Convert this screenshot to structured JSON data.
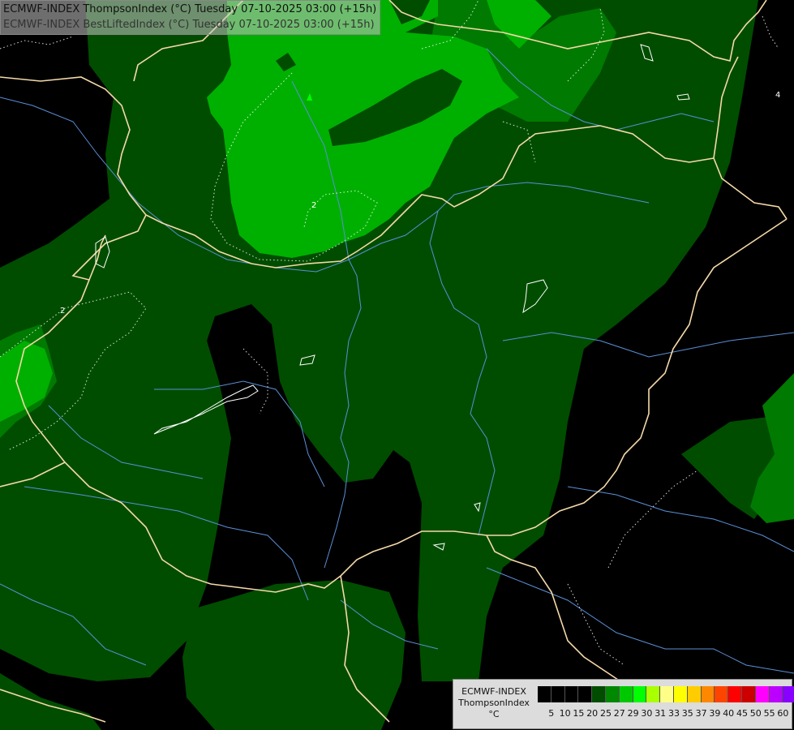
{
  "title": {
    "line1": "ECMWF-INDEX ThompsonIndex (°C) Tuesday 07-10-2025 03:00 (+15h)",
    "line2": "ECMWF-INDEX BestLiftedIndex (°C) Tuesday 07-10-2025 03:00 (+15h)"
  },
  "contour_labels": [
    "2",
    "2",
    "4"
  ],
  "legend": {
    "model": "ECMWF-INDEX",
    "parameter": "ThompsonIndex",
    "unit": "°C",
    "ticks": [
      "5",
      "10",
      "15",
      "20",
      "25",
      "27",
      "29",
      "30",
      "31",
      "33",
      "35",
      "37",
      "39",
      "40",
      "45",
      "50",
      "55",
      "60"
    ],
    "colors": [
      "#000000",
      "#000000",
      "#000000",
      "#000000",
      "#004d00",
      "#008800",
      "#00c800",
      "#00ff00",
      "#aaff00",
      "#ffff88",
      "#ffff00",
      "#ffcc00",
      "#ff8800",
      "#ff4400",
      "#ff0000",
      "#cc0000",
      "#ff00ff",
      "#bb00ff",
      "#8800ff",
      "#4400ff",
      "#0000ff"
    ]
  },
  "colors": {
    "dark_green": "#004d00",
    "mid_green": "#008800",
    "light_green": "#00c800",
    "border": "#f5d9a8",
    "river": "#5a8fd6"
  }
}
